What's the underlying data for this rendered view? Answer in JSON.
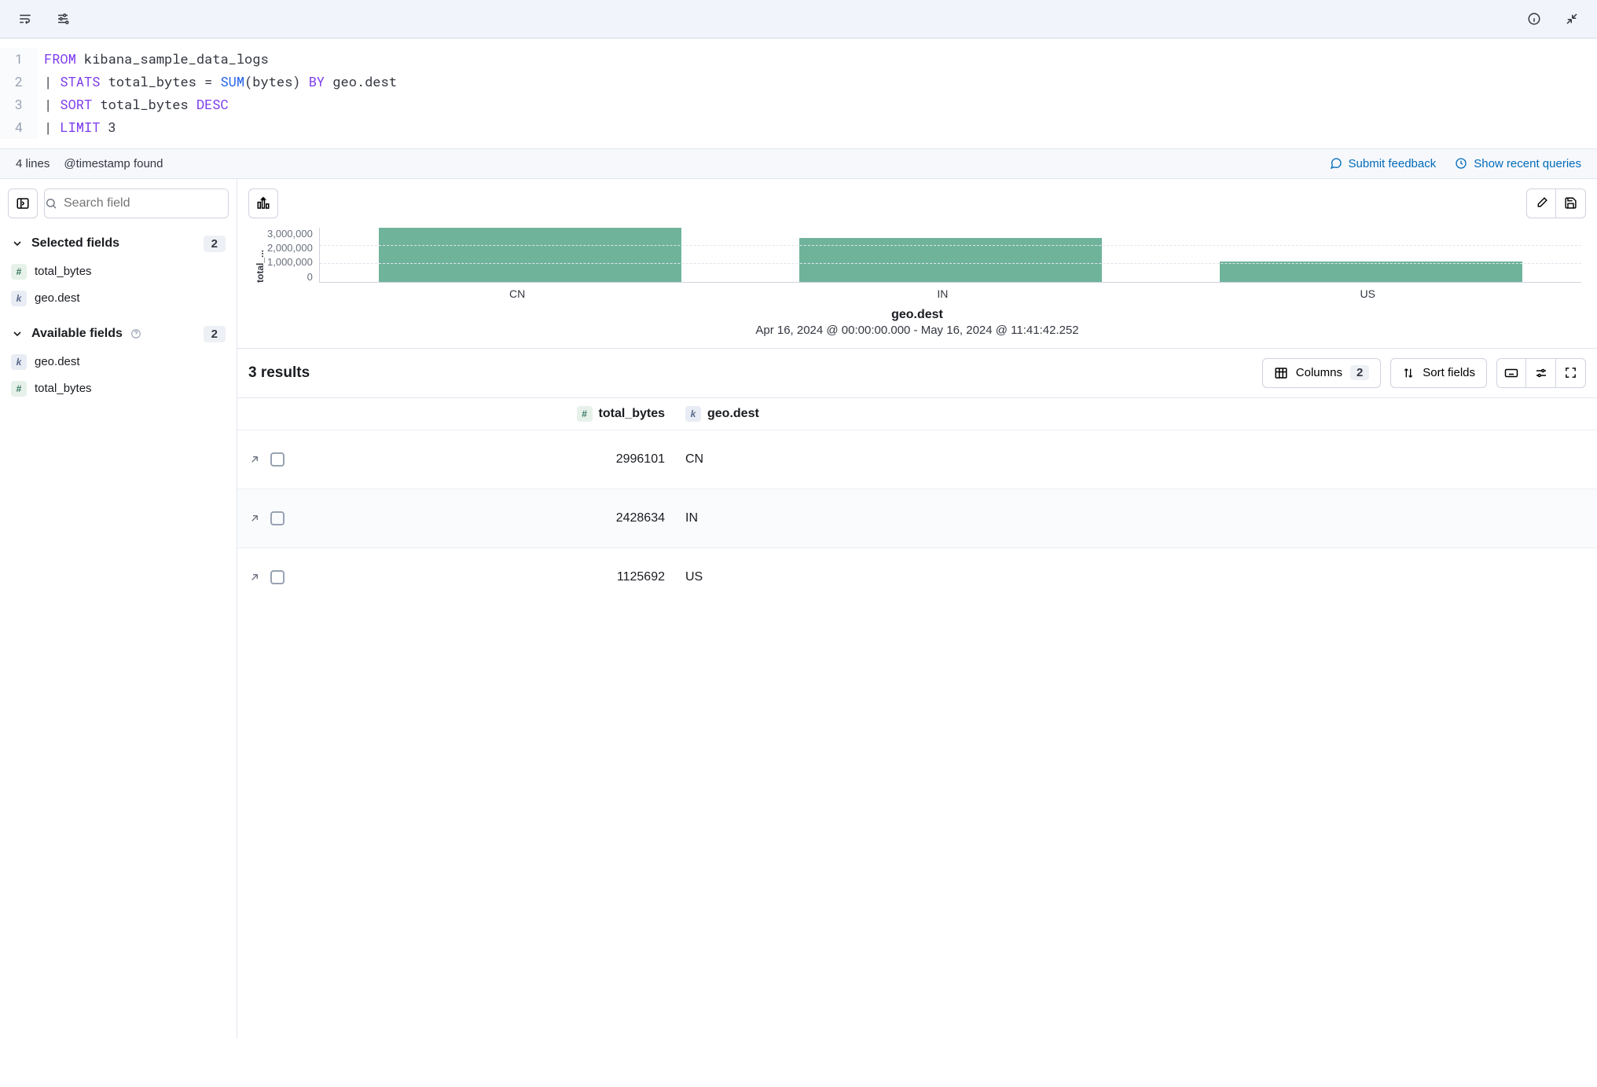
{
  "editor": {
    "lines": [
      {
        "num": "1",
        "tokens": [
          [
            "kw",
            "FROM"
          ],
          [
            "plain",
            " kibana_sample_data_logs"
          ]
        ]
      },
      {
        "num": "2",
        "tokens": [
          [
            "plain",
            "| "
          ],
          [
            "kw",
            "STATS"
          ],
          [
            "plain",
            " total_bytes = "
          ],
          [
            "fn",
            "SUM"
          ],
          [
            "plain",
            "(bytes) "
          ],
          [
            "kw",
            "BY"
          ],
          [
            "plain",
            " geo.dest"
          ]
        ]
      },
      {
        "num": "3",
        "tokens": [
          [
            "plain",
            "| "
          ],
          [
            "kw",
            "SORT"
          ],
          [
            "plain",
            " total_bytes "
          ],
          [
            "kw",
            "DESC"
          ]
        ]
      },
      {
        "num": "4",
        "tokens": [
          [
            "plain",
            "| "
          ],
          [
            "kw",
            "LIMIT"
          ],
          [
            "plain",
            " 3"
          ]
        ]
      }
    ]
  },
  "status": {
    "lines": "4 lines",
    "timestamp": "@timestamp found",
    "feedback": "Submit feedback",
    "recent": "Show recent queries"
  },
  "sidebar": {
    "search_placeholder": "Search field",
    "filter_count": "0",
    "selected": {
      "title": "Selected fields",
      "count": "2",
      "items": [
        {
          "type": "num",
          "label": "total_bytes"
        },
        {
          "type": "kw",
          "label": "geo.dest"
        }
      ]
    },
    "available": {
      "title": "Available fields",
      "count": "2",
      "items": [
        {
          "type": "kw",
          "label": "geo.dest"
        },
        {
          "type": "num",
          "label": "total_bytes"
        }
      ]
    }
  },
  "chart_data": {
    "type": "bar",
    "categories": [
      "CN",
      "IN",
      "US"
    ],
    "values": [
      2996101,
      2428634,
      1125692
    ],
    "ylabel": "total_...",
    "xlabel": "geo.dest",
    "ylim": [
      0,
      3000000
    ],
    "yticks": [
      "3,000,000",
      "2,000,000",
      "1,000,000",
      "0"
    ],
    "subtitle": "Apr 16, 2024 @ 00:00:00.000 - May 16, 2024 @ 11:41:42.252"
  },
  "results": {
    "title": "3 results",
    "columns_label": "Columns",
    "columns_count": "2",
    "sort_label": "Sort fields",
    "headers": {
      "bytes": "total_bytes",
      "dest": "geo.dest"
    },
    "rows": [
      {
        "bytes": "2996101",
        "dest": "CN"
      },
      {
        "bytes": "2428634",
        "dest": "IN"
      },
      {
        "bytes": "1125692",
        "dest": "US"
      }
    ]
  },
  "type_glyph": {
    "num": "#",
    "kw": "k"
  }
}
